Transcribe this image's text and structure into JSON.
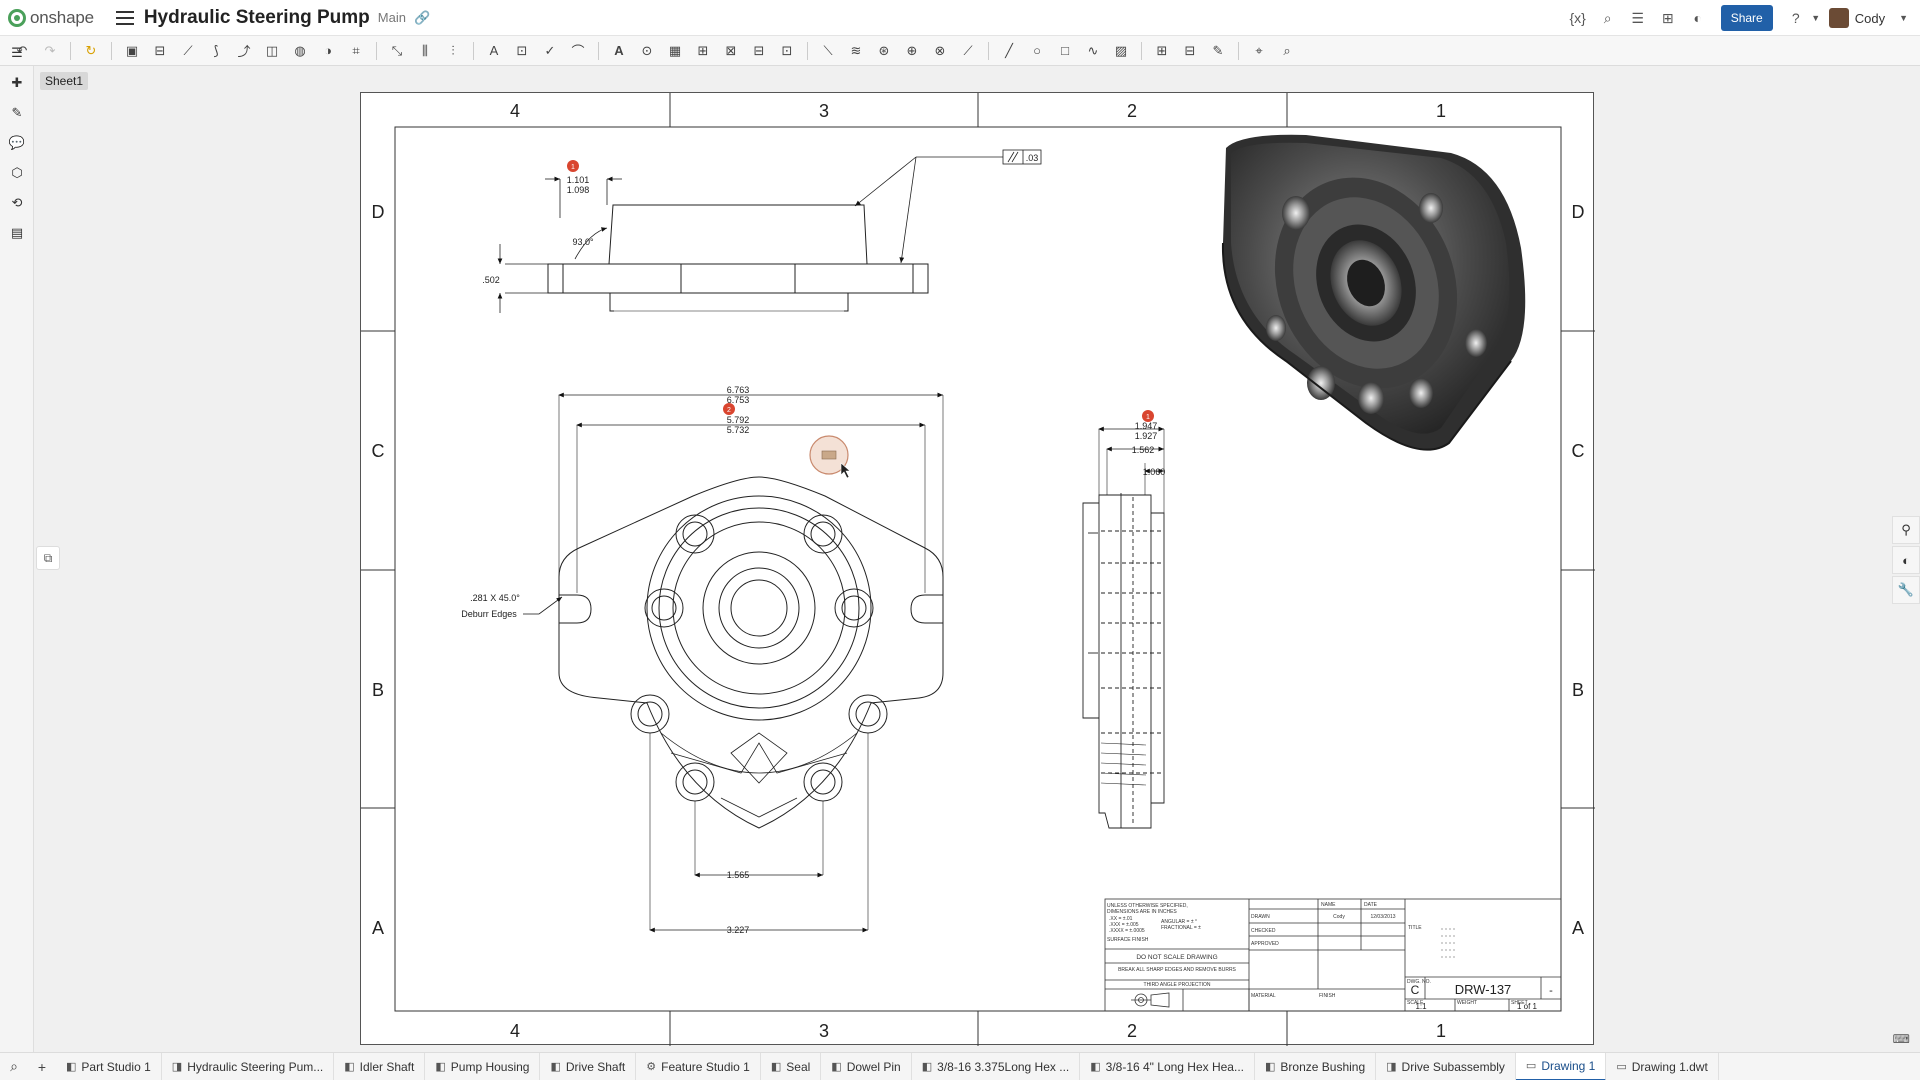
{
  "app": {
    "logo_text": "onshape",
    "doc_title": "Hydraulic Steering Pump",
    "branch": "Main",
    "share_label": "Share",
    "user_name": "Cody"
  },
  "sheet": {
    "tab_label": "Sheet1",
    "col_labels_top": [
      "4",
      "3",
      "2",
      "1"
    ],
    "col_labels_bottom": [
      "4",
      "3",
      "2",
      "1"
    ],
    "row_labels": [
      "D",
      "C",
      "B",
      "A"
    ]
  },
  "dims": {
    "top_view": {
      "balloon": "1",
      "dim_upper": "1.101",
      "dim_lower": "1.098",
      "angle": "93.0°",
      "height": ".502",
      "parallel_tol": ".03"
    },
    "front_view": {
      "balloon": "2",
      "width_upper": "6.763",
      "width_lower": "6.753",
      "slot_upper": "5.792",
      "slot_lower": "5.732",
      "chamfer": ".281 X 45.0°",
      "deburr": "Deburr Edges",
      "bottom_inner": "1.565",
      "bottom_outer": "3.227"
    },
    "side_view": {
      "balloon": "1",
      "dim_upper": "1.947",
      "dim_lower": "1.927",
      "dim_mid": "1.562",
      "dim_small": "1.060"
    }
  },
  "title_block": {
    "notes": [
      "UNLESS OTHERWISE SPECIFIED,",
      "DIMENSIONS ARE IN INCHES",
      ".XX = ±.01",
      ".XXX = ±.005",
      ".XXXX = ±.0005",
      "ANGULAR = ± °",
      "FRACTIONAL = ±",
      "SURFACE FINISH"
    ],
    "do_not_scale": "DO NOT SCALE DRAWING",
    "break_edges": "BREAK ALL SHARP EDGES AND REMOVE BURRS",
    "projection": "THIRD ANGLE PROJECTION",
    "headers": {
      "name": "NAME",
      "date": "DATE",
      "title": "TITLE",
      "material": "MATERIAL",
      "finish": "FINISH"
    },
    "rows": [
      {
        "label": "DRAWN",
        "name": "Cody",
        "date": "12/03/2013"
      },
      {
        "label": "CHECKED",
        "name": "",
        "date": ""
      },
      {
        "label": "APPROVED",
        "name": "",
        "date": ""
      }
    ],
    "size": "C",
    "dwg_no_label": "DWG. NO.",
    "dwg_no": "DRW-137",
    "rev": "-",
    "scale_label": "SCALE",
    "scale": "1:1",
    "weight_label": "WEIGHT",
    "sheet_label": "SHEET",
    "sheet_of": "1 of 1"
  },
  "bottom_tabs": [
    {
      "label": "Part Studio 1",
      "icon": "part-studio-icon",
      "active": false
    },
    {
      "label": "Hydraulic Steering Pum...",
      "icon": "assembly-icon",
      "active": false
    },
    {
      "label": "Idler Shaft",
      "icon": "part-studio-icon",
      "active": false
    },
    {
      "label": "Pump Housing",
      "icon": "part-studio-icon",
      "active": false
    },
    {
      "label": "Drive Shaft",
      "icon": "part-studio-icon",
      "active": false
    },
    {
      "label": "Feature Studio 1",
      "icon": "feature-studio-icon",
      "active": false
    },
    {
      "label": "Seal",
      "icon": "part-studio-icon",
      "active": false
    },
    {
      "label": "Dowel Pin",
      "icon": "part-studio-icon",
      "active": false
    },
    {
      "label": "3/8-16 3.375Long Hex ...",
      "icon": "part-studio-icon",
      "active": false
    },
    {
      "label": "3/8-16 4\" Long Hex Hea...",
      "icon": "part-studio-icon",
      "active": false
    },
    {
      "label": "Bronze Bushing",
      "icon": "part-studio-icon",
      "active": false
    },
    {
      "label": "Drive Subassembly",
      "icon": "assembly-icon",
      "active": false
    },
    {
      "label": "Drawing 1",
      "icon": "drawing-icon",
      "active": true
    },
    {
      "label": "Drawing 1.dwt",
      "icon": "drawing-icon",
      "active": false
    }
  ],
  "colors": {
    "accent": "#2160a8",
    "balloon": "#d9452f",
    "brand_green": "#4aa05a",
    "part_dark": "#3a3a3a"
  }
}
